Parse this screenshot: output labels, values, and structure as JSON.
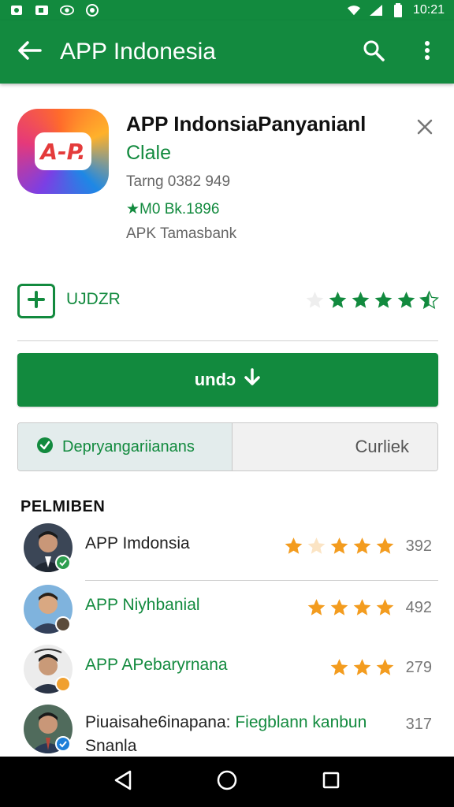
{
  "status_bar": {
    "time": "10:21"
  },
  "app_bar": {
    "title": "APP Indonesia"
  },
  "app": {
    "name": "APP IndonsiaPanyanianl",
    "developer": "Clale",
    "meta": "Tarng 0382 949",
    "downloads": "★M0 B​k.1896",
    "category": "APK Tamasbank",
    "icon_text": "A-P."
  },
  "wishlist_label": "UJDZR",
  "rating_stars": 4.5,
  "install_label": "undɔ",
  "segments": {
    "left": "Depryangariianans",
    "right": "Curliek"
  },
  "section_title": "PELMIBEN",
  "list": [
    {
      "title": "APP Imdonsia",
      "count": "392",
      "stars": 4,
      "title_color": "#212121",
      "badge_color": "#2e9e4f",
      "avatar_bg": "#3b4656"
    },
    {
      "title": "APP Niyhbanial",
      "count": "492",
      "stars": 4,
      "title_color": "#128a3e",
      "badge_color": "#5b4b3b",
      "avatar_bg": "#6fa7d8"
    },
    {
      "title": "APP APebaryrnana",
      "count": "279",
      "stars": 3,
      "title_color": "#128a3e",
      "badge_color": "#f0a030",
      "avatar_bg": "#e8e8e8"
    },
    {
      "title_line1_a": "Piuaisahe6inapana: ",
      "title_line1_b": "Fiegblann kanbun",
      "title_line2": "Snanla",
      "count": "317",
      "badge_color": "#1e7fd8",
      "avatar_bg": "#3e5a4c"
    }
  ],
  "colors": {
    "brand_green": "#138a3f",
    "star_green": "#128a3e",
    "star_orange": "#f39c1f"
  },
  "icons": [
    "back-arrow-icon",
    "search-icon",
    "more-vert-icon",
    "close-icon",
    "plus-icon",
    "download-icon",
    "check-circle-icon",
    "nav-back-icon",
    "nav-home-icon",
    "nav-recents-icon"
  ]
}
